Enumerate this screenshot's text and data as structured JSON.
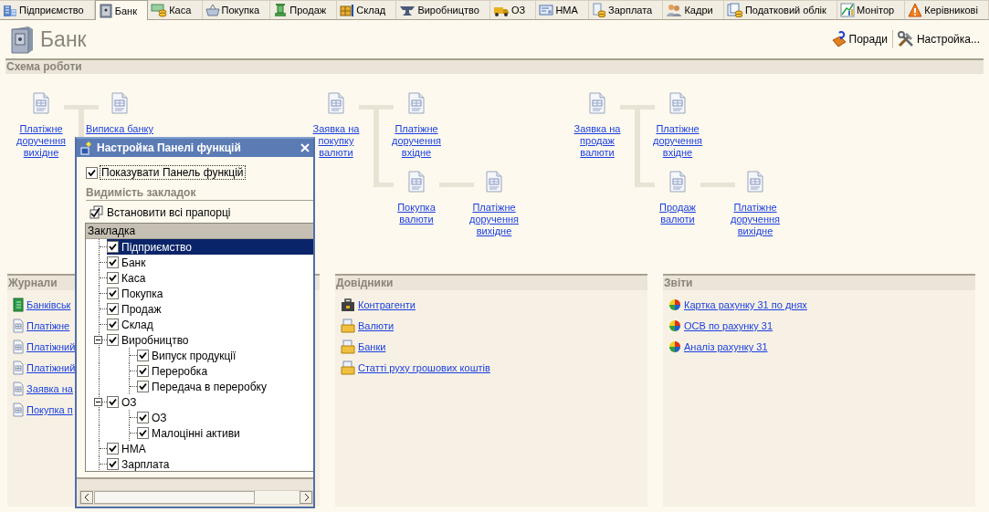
{
  "tabs": [
    {
      "label": "Підприємство",
      "selected": false
    },
    {
      "label": "Банк",
      "selected": true
    },
    {
      "label": "Каса",
      "selected": false
    },
    {
      "label": "Покупка",
      "selected": false
    },
    {
      "label": "Продаж",
      "selected": false
    },
    {
      "label": "Склад",
      "selected": false
    },
    {
      "label": "Виробництво",
      "selected": false
    },
    {
      "label": "ОЗ",
      "selected": false
    },
    {
      "label": "НМА",
      "selected": false
    },
    {
      "label": "Зарплата",
      "selected": false
    },
    {
      "label": "Кадри",
      "selected": false
    },
    {
      "label": "Податковий облік",
      "selected": false
    },
    {
      "label": "Монітор",
      "selected": false
    },
    {
      "label": "Керівникові",
      "selected": false
    }
  ],
  "header": {
    "title": "Банк",
    "links": [
      {
        "label": "Поради"
      },
      {
        "label": "Настройка..."
      }
    ]
  },
  "scheme": {
    "title": "Схема роботи",
    "nodes": [
      {
        "label": "Платіжне доручення вихідне"
      },
      {
        "label": "Виписка банку"
      },
      {
        "label": "Заявка на покупку валюти"
      },
      {
        "label": "Платіжне доручення вхідне"
      },
      {
        "label": "Покупка валюти"
      },
      {
        "label": "Платіжне доручення вихідне"
      },
      {
        "label": "Заявка на продаж валюти"
      },
      {
        "label": "Платіжне доручення вхідне"
      },
      {
        "label": "Продаж валюти"
      },
      {
        "label": "Платіжне доручення вихідне"
      }
    ]
  },
  "panels": [
    {
      "title": "Журнали",
      "links": [
        {
          "label": "Банківськ",
          "kind": "journal"
        },
        {
          "label": "Платіжне",
          "kind": "document"
        },
        {
          "label": "Платіжний",
          "kind": "document"
        },
        {
          "label": "Платіжний",
          "kind": "document"
        },
        {
          "label": "Заявка на",
          "kind": "document"
        },
        {
          "label": "Покупка п",
          "kind": "document"
        }
      ]
    },
    {
      "title": "Довідники",
      "links": [
        {
          "label": "Контрагенти",
          "kind": "catalog"
        },
        {
          "label": "Валюти",
          "kind": "folder"
        },
        {
          "label": "Банки",
          "kind": "folder"
        },
        {
          "label": "Статті руху грошових коштів",
          "kind": "folder"
        }
      ]
    },
    {
      "title": "Звіти",
      "links": [
        {
          "label": "Картка рахунку 31 по днях",
          "kind": "report"
        },
        {
          "label": "ОСВ по рахунку 31",
          "kind": "report"
        },
        {
          "label": "Аналіз рахунку 31",
          "kind": "report"
        }
      ]
    }
  ],
  "dialog": {
    "title": "Настройка Панелі функцій",
    "show_panel": {
      "label": "Показувати Панель функцій",
      "checked": true
    },
    "section": "Видимість закладок",
    "set_all": "Встановити всі прапорці",
    "column": "Закладка",
    "tree": [
      {
        "label": "Підприємство",
        "checked": true,
        "selected": true
      },
      {
        "label": "Банк",
        "checked": true,
        "selected": false
      },
      {
        "label": "Каса",
        "checked": true,
        "selected": false
      },
      {
        "label": "Покупка",
        "checked": true,
        "selected": false
      },
      {
        "label": "Продаж",
        "checked": true,
        "selected": false
      },
      {
        "label": "Склад",
        "checked": true,
        "selected": false
      },
      {
        "label": "Виробництво",
        "checked": true,
        "selected": false,
        "expanded": true,
        "children": [
          {
            "label": "Випуск продукції",
            "checked": true,
            "selected": false
          },
          {
            "label": "Переробка",
            "checked": true,
            "selected": false
          },
          {
            "label": "Передача в переробку",
            "checked": true,
            "selected": false
          }
        ]
      },
      {
        "label": "ОЗ",
        "checked": true,
        "selected": false,
        "expanded": true,
        "children": [
          {
            "label": "ОЗ",
            "checked": true,
            "selected": false
          },
          {
            "label": "Малоцінні активи",
            "checked": true,
            "selected": false
          }
        ]
      },
      {
        "label": "НМА",
        "checked": true,
        "selected": false
      },
      {
        "label": "Зарплата",
        "checked": true,
        "selected": false
      }
    ]
  }
}
